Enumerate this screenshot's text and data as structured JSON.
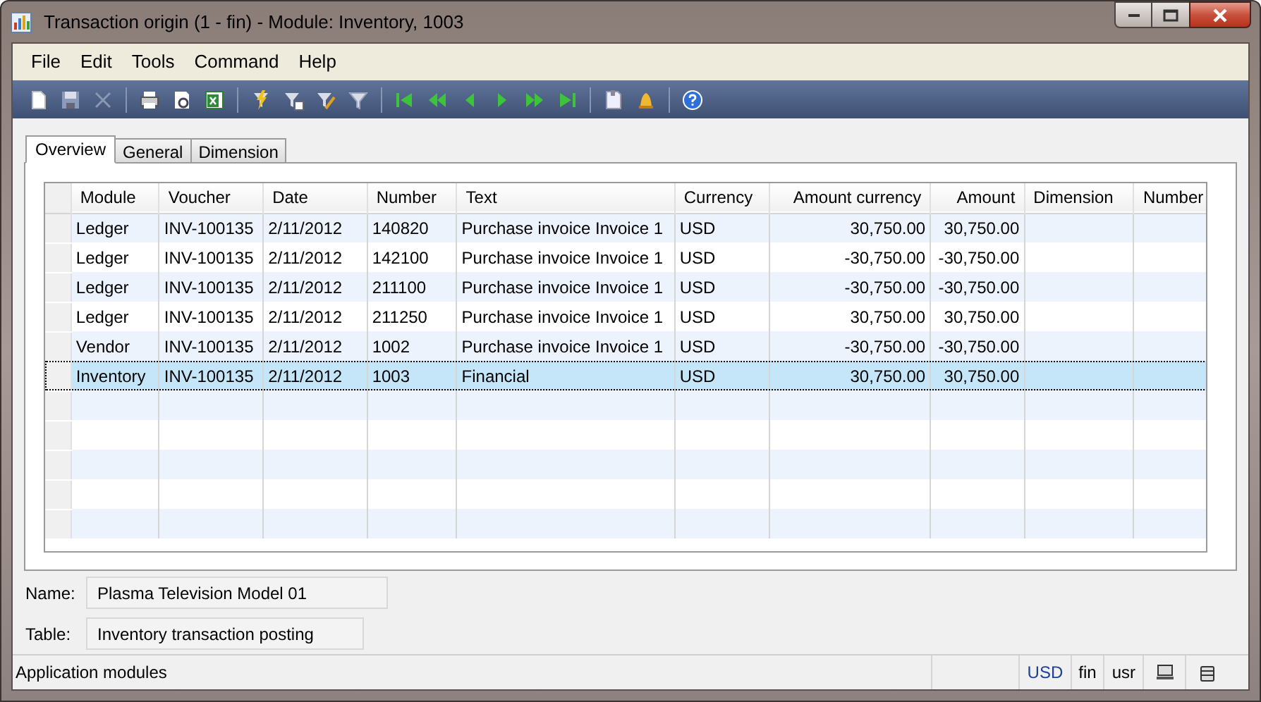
{
  "window": {
    "title": "Transaction origin (1 - fin) - Module: Inventory, 1003"
  },
  "menu": [
    "File",
    "Edit",
    "Tools",
    "Command",
    "Help"
  ],
  "tabs": [
    {
      "label": "Overview",
      "selected": true
    },
    {
      "label": "General",
      "selected": false
    },
    {
      "label": "Dimension",
      "selected": false
    }
  ],
  "table": {
    "columns": [
      {
        "label": "Module"
      },
      {
        "label": "Voucher"
      },
      {
        "label": "Date"
      },
      {
        "label": "Number"
      },
      {
        "label": "Text"
      },
      {
        "label": "Currency"
      },
      {
        "label": "Amount currency"
      },
      {
        "label": "Amount"
      },
      {
        "label": "Dimension"
      },
      {
        "label": "Number"
      }
    ],
    "rows": [
      {
        "selected": false,
        "cells": [
          "Ledger",
          "INV-100135",
          "2/11/2012",
          "140820",
          "Purchase invoice Invoice 1",
          "USD",
          "30,750.00",
          "30,750.00"
        ]
      },
      {
        "selected": false,
        "cells": [
          "Ledger",
          "INV-100135",
          "2/11/2012",
          "142100",
          "Purchase invoice Invoice 1",
          "USD",
          "-30,750.00",
          "-30,750.00"
        ]
      },
      {
        "selected": false,
        "cells": [
          "Ledger",
          "INV-100135",
          "2/11/2012",
          "211100",
          "Purchase invoice Invoice 1",
          "USD",
          "-30,750.00",
          "-30,750.00"
        ]
      },
      {
        "selected": false,
        "cells": [
          "Ledger",
          "INV-100135",
          "2/11/2012",
          "211250",
          "Purchase invoice Invoice 1",
          "USD",
          "30,750.00",
          "30,750.00"
        ]
      },
      {
        "selected": false,
        "cells": [
          "Vendor",
          "INV-100135",
          "2/11/2012",
          "1002",
          "Purchase invoice Invoice 1",
          "USD",
          "-30,750.00",
          "-30,750.00"
        ]
      },
      {
        "selected": true,
        "cells": [
          "Inventory",
          "INV-100135",
          "2/11/2012",
          "1003",
          "Financial",
          "USD",
          "30,750.00",
          "30,750.00"
        ]
      }
    ]
  },
  "fields": [
    {
      "label": "Name:",
      "value": "Plasma Television Model 01"
    },
    {
      "label": "Table:",
      "value": "Inventory transaction posting"
    }
  ],
  "status_bar": {
    "text": "Application modules",
    "currency": "USD",
    "company": "fin",
    "user": "usr"
  }
}
